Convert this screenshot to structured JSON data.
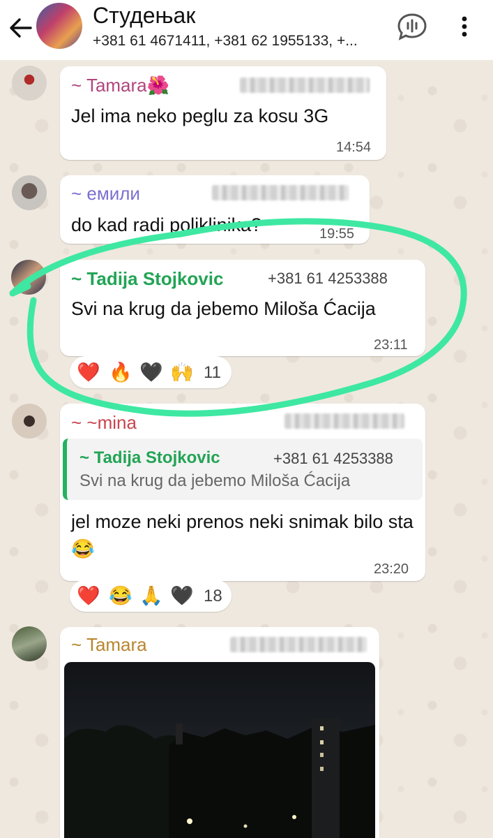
{
  "header": {
    "title": "Студењак",
    "subtitle": "+381 61 4671411, +381 62 1955133, +..."
  },
  "messages": [
    {
      "sender": "~ Tamara🌺",
      "text": "Jel ima neko peglu za kosu 3G",
      "time": "14:54",
      "sender_color": "#b0457d"
    },
    {
      "sender": "~ емили",
      "text": "do kad radi poliklinika?",
      "time": "19:55",
      "sender_color": "#7b6fcf"
    },
    {
      "sender": "~ Tadija Stojkovic",
      "phone": "+381 61 4253388",
      "text": "Svi na krug da jebemo Miloša Ćacija",
      "time": "23:11",
      "sender_color": "#22a455",
      "reactions": {
        "emojis": [
          "❤️",
          "🔥",
          "🖤",
          "🙌"
        ],
        "count": "11"
      }
    },
    {
      "sender": "~ ~mina",
      "quote": {
        "sender": "~ Tadija Stojkovic",
        "phone": "+381 61 4253388",
        "text": "Svi na krug da jebemo Miloša Ćacija"
      },
      "text": "jel moze neki prenos neki snimak bilo sta😂",
      "time": "23:20",
      "sender_color": "#c8454e",
      "reactions": {
        "emojis": [
          "❤️",
          "😂",
          "🙏",
          "🖤"
        ],
        "count": "18"
      }
    },
    {
      "sender": "~ Tamara",
      "sender_color": "#b8862e",
      "media": "photo"
    }
  ],
  "colors": {
    "annotation": "#3ee8a2",
    "wallpaper": "#efe8df"
  }
}
